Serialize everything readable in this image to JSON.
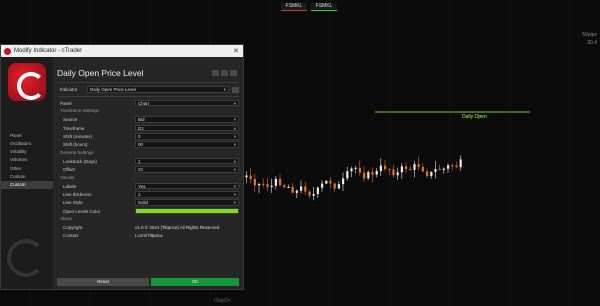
{
  "chart": {
    "top_badges": [
      "FSMKL",
      "FSMKL"
    ],
    "right_tags": [
      "50pips",
      "30.4"
    ],
    "daily_open_label": "Daily Open",
    "x_labels": [
      "ITalyDn"
    ],
    "colors": {
      "up": "#e9e9e9",
      "down": "#e8701a",
      "daily_open_line": "#b4ff3c",
      "grid": "#1e1e1e"
    }
  },
  "dialog": {
    "window_title": "Modify Indicator - cTrader",
    "close_label": "✕",
    "indicator_title": "Daily Open Price Level",
    "indicator_label": "Indicator",
    "indicator_value": "Daily Open Price Level",
    "sidebar": [
      "Panel",
      "Oscillators",
      "Volatility",
      "Volumes",
      "Other",
      "Custom",
      "Custom"
    ],
    "rows": {
      "panel": {
        "label": "Panel",
        "value": "Chart"
      },
      "timeframe_header": "Timeframe Settings",
      "source": {
        "label": "Source",
        "value": "Bid"
      },
      "timeframe": {
        "label": "Timeframe",
        "value": "D1"
      },
      "shift_minutes": {
        "label": "Shift (minutes)",
        "value": "0"
      },
      "shift_hours": {
        "label": "Shift (hours)",
        "value": "00"
      },
      "general_header": "General Settings",
      "lookback": {
        "label": "Lookback (Days)",
        "value": "1"
      },
      "offset": {
        "label": "Offset",
        "value": "22"
      },
      "visuals_header": "Visuals",
      "labels": {
        "label": "Labels",
        "value": "Yes"
      },
      "line_thickness": {
        "label": "Line thickness",
        "value": "1"
      },
      "line_style": {
        "label": "Line Style",
        "value": "Solid"
      },
      "open_levels_color": {
        "label": "Open Levels Color",
        "value": "#7ddc1e"
      },
      "about_header": "About",
      "copyright": {
        "label": "Copyright",
        "value": "v1.0 © 2024 [Tiltprice] All Rights Reserved"
      },
      "contact": {
        "label": "Contact",
        "value": "t.com/Tiltprice"
      }
    },
    "buttons": {
      "reset": "Reset",
      "ok": "OK"
    }
  }
}
